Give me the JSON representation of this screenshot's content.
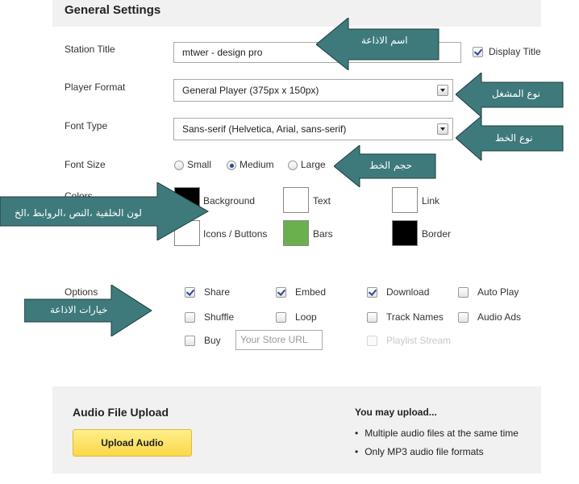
{
  "general": {
    "title": "General Settings"
  },
  "station_title": {
    "label": "Station Title",
    "value": "mtwer - design pro",
    "display_title_label": "Display Title",
    "display_title_checked": true
  },
  "player_format": {
    "label": "Player Format",
    "selected": "General Player (375px x 150px)"
  },
  "font_type": {
    "label": "Font Type",
    "selected": "Sans-serif (Helvetica, Arial, sans-serif)"
  },
  "font_size": {
    "label": "Font Size",
    "options": [
      "Small",
      "Medium",
      "Large"
    ],
    "selected": "Medium"
  },
  "colors": {
    "label": "Colors",
    "items": [
      {
        "label": "Background",
        "color": "#000000"
      },
      {
        "label": "Text",
        "color": "#ffffff"
      },
      {
        "label": "Link",
        "color": "#ffffff"
      },
      {
        "label": "Icons / Buttons",
        "color": "#ffffff"
      },
      {
        "label": "Bars",
        "color": "#6ab04c"
      },
      {
        "label": "Border",
        "color": "#000000"
      }
    ]
  },
  "options": {
    "label": "Options",
    "items": [
      {
        "label": "Share",
        "checked": true
      },
      {
        "label": "Embed",
        "checked": true
      },
      {
        "label": "Download",
        "checked": true
      },
      {
        "label": "Auto Play",
        "checked": false
      },
      {
        "label": "Shuffle",
        "checked": false
      },
      {
        "label": "Loop",
        "checked": false
      },
      {
        "label": "Track Names",
        "checked": false
      },
      {
        "label": "Audio Ads",
        "checked": false
      },
      {
        "label": "Buy",
        "checked": false
      }
    ],
    "store_url_placeholder": "Your Store URL",
    "playlist_stream_label": "Playlist Stream",
    "playlist_stream_disabled": true
  },
  "upload": {
    "title": "Audio File Upload",
    "button_label": "Upload Audio",
    "may_upload_title": "You may upload...",
    "may_upload_items": [
      "Multiple audio files at the same time",
      "Only MP3 audio file formats"
    ]
  },
  "annotations": {
    "color": "#3e7a7c",
    "station_name": "اسم الاذاعة",
    "player_type": "نوع المشغل",
    "font_type": "نوع الخط",
    "font_size": "حجم الخط",
    "colors": "لون الخلفية ،النص ،الروابط ،الخ",
    "options": "خيارات الاذاعة"
  }
}
